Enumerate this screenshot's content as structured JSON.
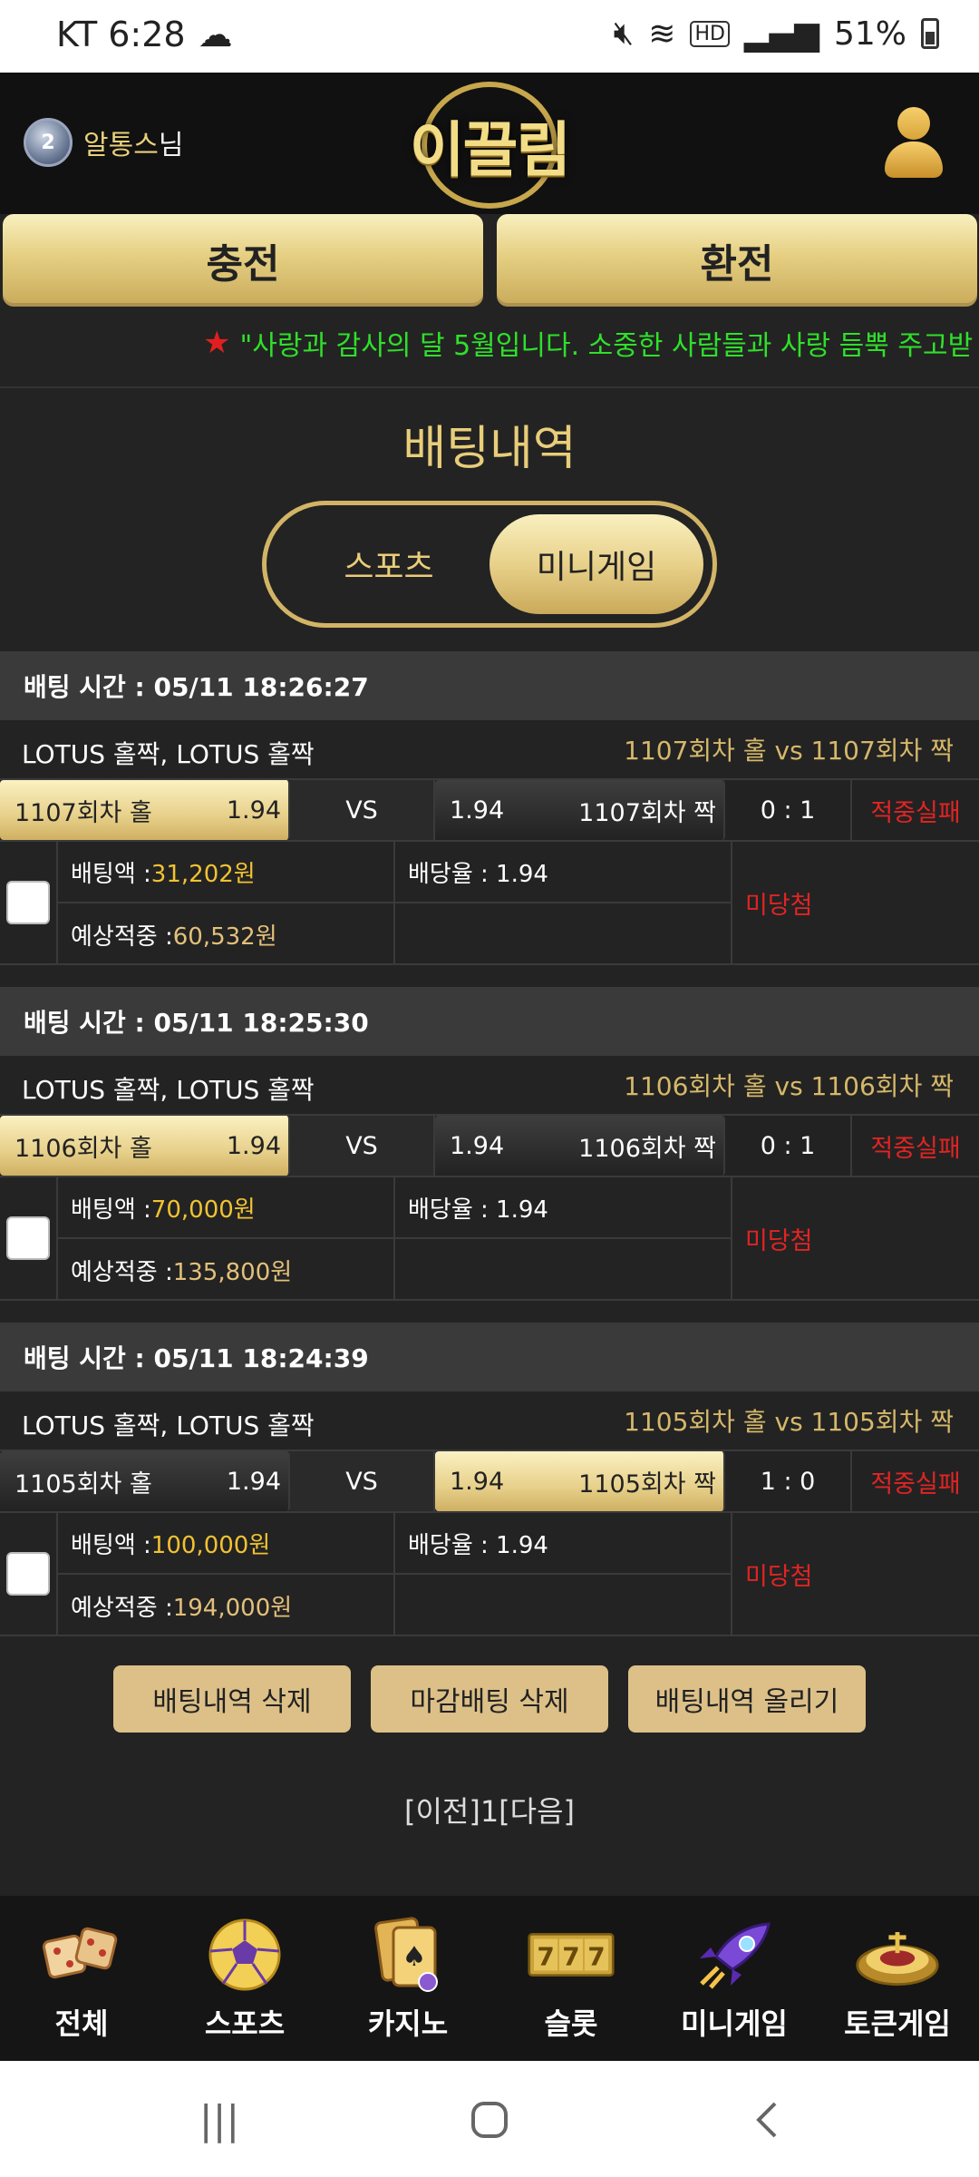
{
  "status_bar": {
    "carrier_time": "KT 6:28",
    "battery": "51%",
    "hd": "HD"
  },
  "header": {
    "username": "알통스",
    "username_suffix": "님",
    "logo_text": "이끌림",
    "level": "2"
  },
  "buttons": {
    "charge": "충전",
    "exchange": "환전"
  },
  "notice": {
    "text": "\"사랑과 감사의 달 5월입니다. 소중한 사람들과 사랑 듬뿍 주고받"
  },
  "page": {
    "title": "배팅내역",
    "tabs": {
      "sports": "스포츠",
      "minigame": "미니게임"
    }
  },
  "bets": [
    {
      "time": "배팅 시간 : 05/11 18:26:27",
      "game": "LOTUS 홀짝, LOTUS 홀짝",
      "match": "1107회차 홀  vs  1107회차 짝",
      "home": "1107회차 홀",
      "home_odds": "1.94",
      "vs": "VS",
      "away_odds": "1.94",
      "away": "1107회차 짝",
      "selected": "home",
      "score": "0 : 1",
      "result": "적중실패",
      "amount_label": "배팅액 : ",
      "amount": "31,202원",
      "odds_label": "배당율 : 1.94",
      "expected_label": "예상적중 : ",
      "expected": "60,532원",
      "status": "미당첨"
    },
    {
      "time": "배팅 시간 : 05/11 18:25:30",
      "game": "LOTUS 홀짝, LOTUS 홀짝",
      "match": "1106회차 홀  vs  1106회차 짝",
      "home": "1106회차 홀",
      "home_odds": "1.94",
      "vs": "VS",
      "away_odds": "1.94",
      "away": "1106회차 짝",
      "selected": "home",
      "score": "0 : 1",
      "result": "적중실패",
      "amount_label": "배팅액 : ",
      "amount": "70,000원",
      "odds_label": "배당율 : 1.94",
      "expected_label": "예상적중 : ",
      "expected": "135,800원",
      "status": "미당첨"
    },
    {
      "time": "배팅 시간 : 05/11 18:24:39",
      "game": "LOTUS 홀짝, LOTUS 홀짝",
      "match": "1105회차 홀  vs  1105회차 짝",
      "home": "1105회차 홀",
      "home_odds": "1.94",
      "vs": "VS",
      "away_odds": "1.94",
      "away": "1105회차 짝",
      "selected": "away",
      "score": "1 : 0",
      "result": "적중실패",
      "amount_label": "배팅액 : ",
      "amount": "100,000원",
      "odds_label": "배당율 : 1.94",
      "expected_label": "예상적중 : ",
      "expected": "194,000원",
      "status": "미당첨"
    }
  ],
  "actions": {
    "delete": "배팅내역 삭제",
    "delete_closed": "마감배팅 삭제",
    "post": "배팅내역 올리기"
  },
  "pager": "[이전]1[다음]",
  "bottom_nav": [
    {
      "label": "전체",
      "icon": "dice-icon"
    },
    {
      "label": "스포츠",
      "icon": "soccer-ball-icon"
    },
    {
      "label": "카지노",
      "icon": "playing-cards-icon"
    },
    {
      "label": "슬롯",
      "icon": "slot-777-icon"
    },
    {
      "label": "미니게임",
      "icon": "rocket-icon"
    },
    {
      "label": "토큰게임",
      "icon": "roulette-icon"
    }
  ],
  "colors": {
    "gold": "#e5cf82",
    "notice_green": "#2fe02a",
    "fail_red": "#e02424",
    "background": "#232323"
  }
}
